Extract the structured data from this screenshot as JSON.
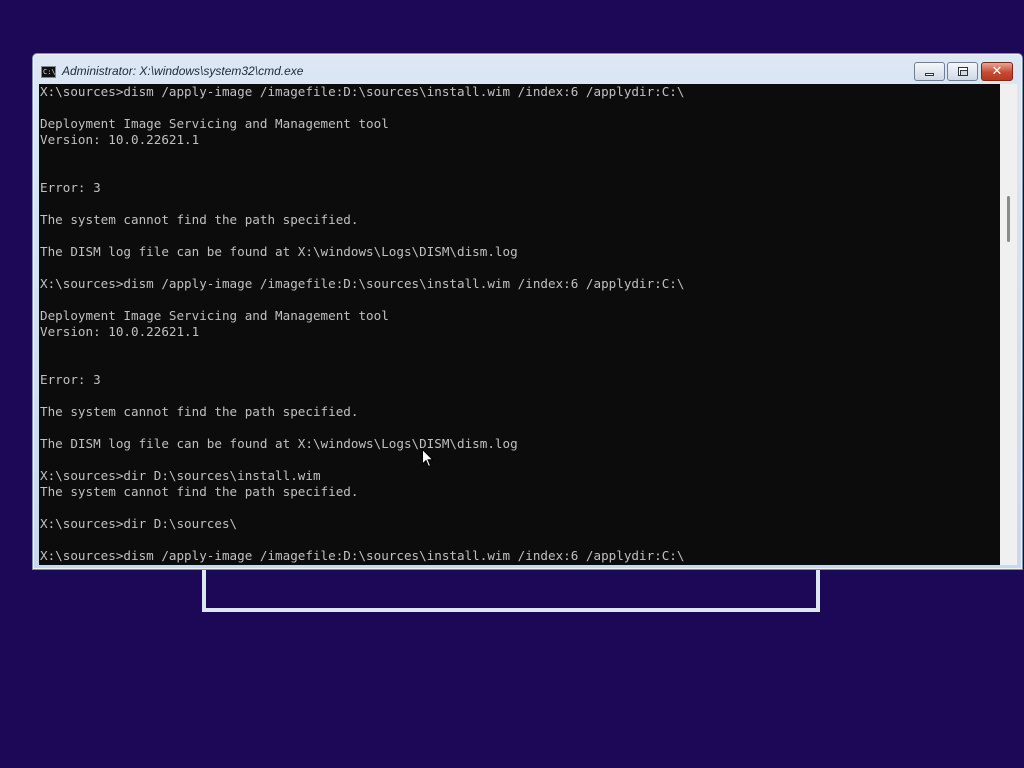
{
  "window": {
    "title": "Administrator: X:\\windows\\system32\\cmd.exe",
    "icon": "cmd-icon",
    "controls": {
      "minimize": "minimize-icon",
      "maximize": "maximize-icon",
      "close": "✕"
    }
  },
  "console": {
    "lines": [
      "X:\\sources>dism /apply-image /imagefile:D:\\sources\\install.wim /index:6 /applydir:C:\\",
      "",
      "Deployment Image Servicing and Management tool",
      "Version: 10.0.22621.1",
      "",
      "",
      "Error: 3",
      "",
      "The system cannot find the path specified.",
      "",
      "The DISM log file can be found at X:\\windows\\Logs\\DISM\\dism.log",
      "",
      "X:\\sources>dism /apply-image /imagefile:D:\\sources\\install.wim /index:6 /applydir:C:\\",
      "",
      "Deployment Image Servicing and Management tool",
      "Version: 10.0.22621.1",
      "",
      "",
      "Error: 3",
      "",
      "The system cannot find the path specified.",
      "",
      "The DISM log file can be found at X:\\windows\\Logs\\DISM\\dism.log",
      "",
      "X:\\sources>dir D:\\sources\\install.wim",
      "The system cannot find the path specified.",
      "",
      "X:\\sources>dir D:\\sources\\",
      "",
      "X:\\sources>dism /apply-image /imagefile:D:\\sources\\install.wim /index:6 /applydir:C:\\"
    ]
  },
  "colors": {
    "desktop_background": "#1c0856",
    "console_background": "#0c0c0c",
    "console_text": "#c0c0c0"
  }
}
